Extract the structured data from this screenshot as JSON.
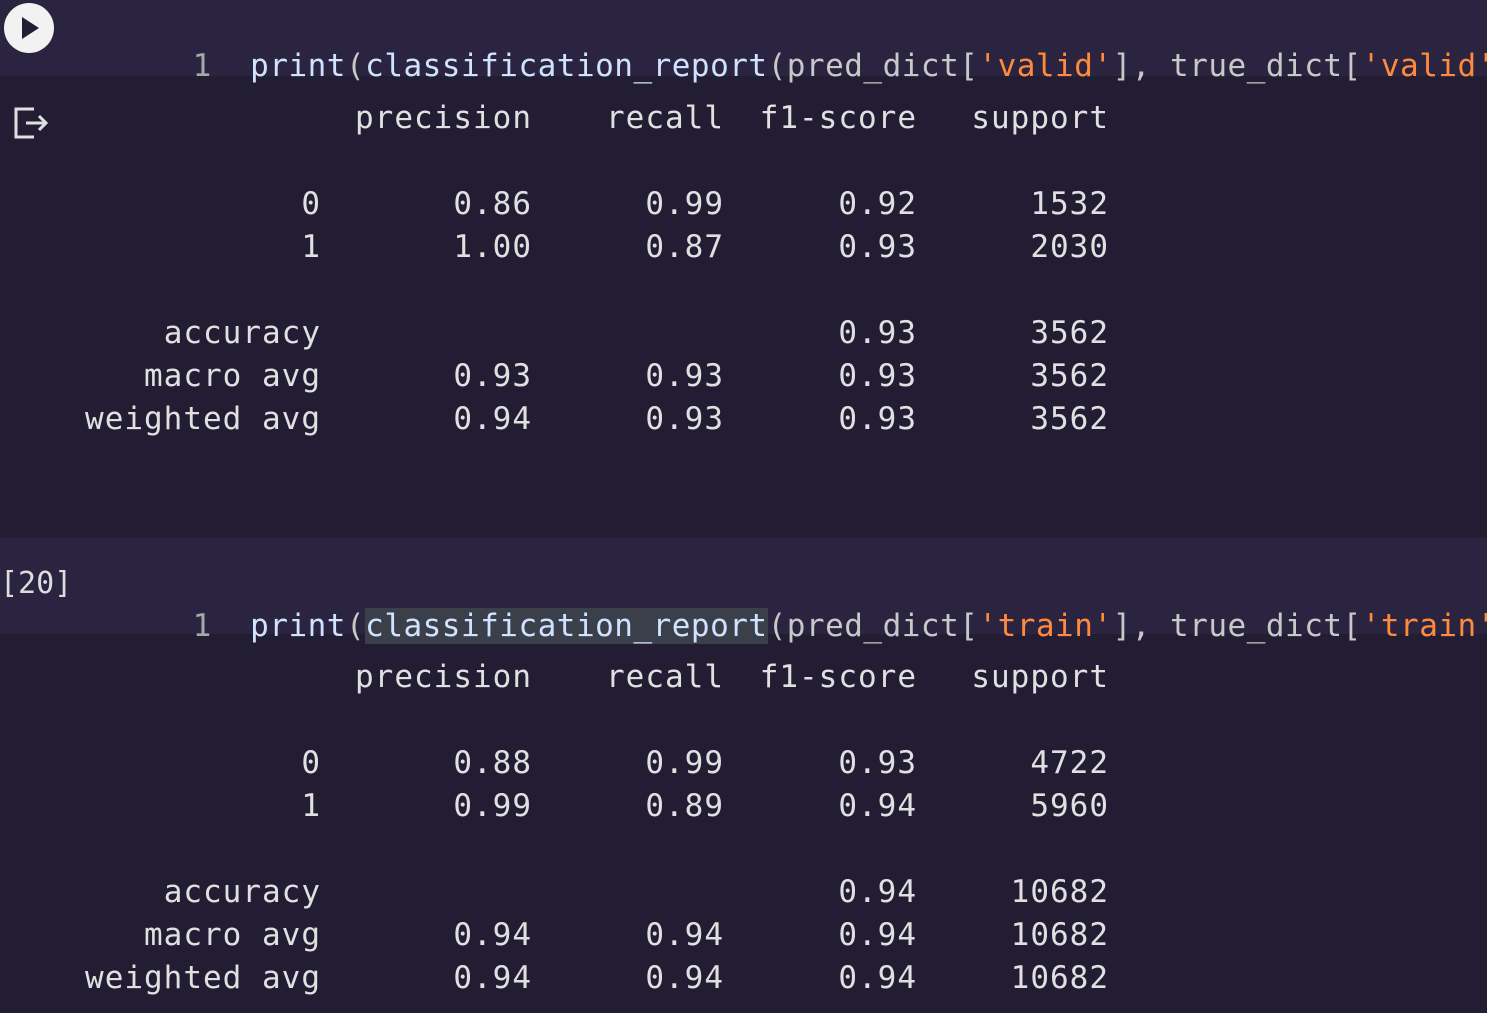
{
  "cells": [
    {
      "execution_count": "",
      "line_number": "1",
      "code": {
        "print": "print",
        "open1": "(",
        "func": "classification_report",
        "open2": "(pred_dict[",
        "str1": "'valid'",
        "mid": "], true_dict[",
        "str2": "'valid'",
        "close": "]))"
      },
      "report": {
        "headers": [
          "precision",
          "recall",
          "f1-score",
          "support"
        ],
        "rows": [
          [
            "0",
            "0.86",
            "0.99",
            "0.92",
            "1532"
          ],
          [
            "1",
            "1.00",
            "0.87",
            "0.93",
            "2030"
          ],
          [
            "accuracy",
            "",
            "",
            "0.93",
            "3562"
          ],
          [
            "macro avg",
            "0.93",
            "0.93",
            "0.93",
            "3562"
          ],
          [
            "weighted avg",
            "0.94",
            "0.93",
            "0.93",
            "3562"
          ]
        ]
      }
    },
    {
      "execution_count": "[20]",
      "line_number": "1",
      "code": {
        "print": "print",
        "open1": "(",
        "func": "classification_report",
        "open2": "(pred_dict[",
        "str1": "'train'",
        "mid": "], true_dict[",
        "str2": "'train'",
        "close": "]))"
      },
      "report": {
        "headers": [
          "precision",
          "recall",
          "f1-score",
          "support"
        ],
        "rows": [
          [
            "0",
            "0.88",
            "0.99",
            "0.93",
            "4722"
          ],
          [
            "1",
            "0.99",
            "0.89",
            "0.94",
            "5960"
          ],
          [
            "accuracy",
            "",
            "",
            "0.94",
            "10682"
          ],
          [
            "macro avg",
            "0.94",
            "0.94",
            "0.94",
            "10682"
          ],
          [
            "weighted avg",
            "0.94",
            "0.94",
            "0.94",
            "10682"
          ]
        ]
      }
    }
  ],
  "icons": {
    "run": "play-icon",
    "output": "output-icon"
  }
}
